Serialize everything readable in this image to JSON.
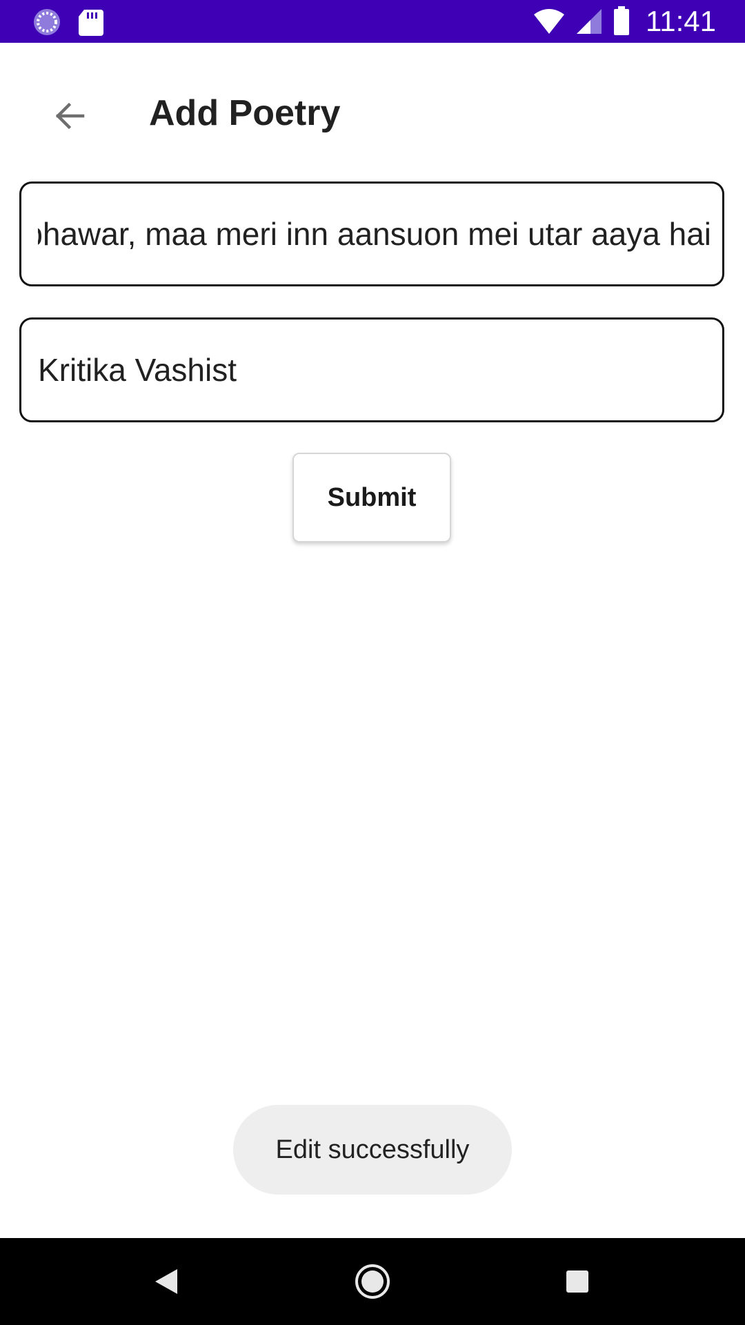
{
  "status_bar": {
    "time": "11:41",
    "icons": [
      "loading-icon",
      "sd-card-icon",
      "wifi-icon",
      "cell-signal-icon",
      "battery-icon"
    ],
    "background_color": "#3f00b5"
  },
  "app_bar": {
    "back_icon": "arrow-back-icon",
    "title": "Add Poetry"
  },
  "form": {
    "poetry_value": "bhawar, maa meri inn aansuon mei utar aaya hai",
    "author_value": "Kritika Vashist",
    "submit_label": "Submit"
  },
  "toast": {
    "message": "Edit successfully"
  },
  "nav_bar": {
    "icons": [
      "nav-back-icon",
      "nav-home-icon",
      "nav-recents-icon"
    ]
  }
}
